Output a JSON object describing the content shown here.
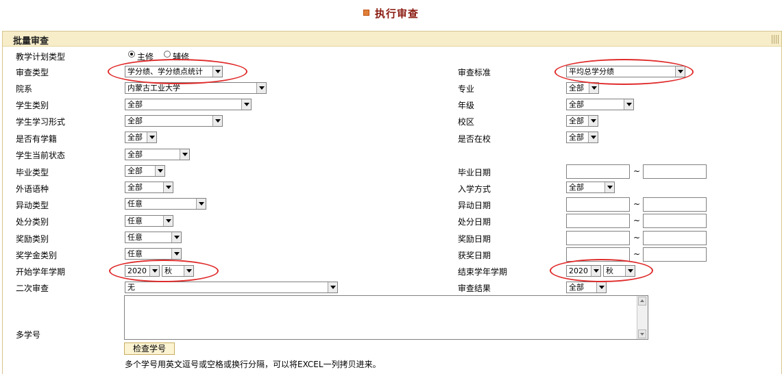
{
  "page_title": "执行审查",
  "panel_title": "批量审查",
  "plan_type": {
    "label": "教学计划类型",
    "options": [
      {
        "label": "主修",
        "checked": true
      },
      {
        "label": "辅修",
        "checked": false
      }
    ]
  },
  "fields": {
    "review_type": {
      "label": "审查类型",
      "value": "学分绩、学分绩点统计"
    },
    "review_standard": {
      "label": "审查标准",
      "value": "平均总学分绩"
    },
    "department": {
      "label": "院系",
      "value": "内蒙古工业大学"
    },
    "major": {
      "label": "专业",
      "value": "全部"
    },
    "student_category": {
      "label": "学生类别",
      "value": "全部"
    },
    "grade": {
      "label": "年级",
      "value": "全部"
    },
    "study_form": {
      "label": "学生学习形式",
      "value": "全部"
    },
    "campus": {
      "label": "校区",
      "value": "全部"
    },
    "has_status": {
      "label": "是否有学籍",
      "value": "全部"
    },
    "in_school": {
      "label": "是否在校",
      "value": "全部"
    },
    "current_state": {
      "label": "学生当前状态",
      "value": "全部"
    },
    "graduation_type": {
      "label": "毕业类型",
      "value": "全部"
    },
    "graduation_date": {
      "label": "毕业日期"
    },
    "language": {
      "label": "外语语种",
      "value": "全部"
    },
    "admission_method": {
      "label": "入学方式",
      "value": "全部"
    },
    "change_type": {
      "label": "异动类型",
      "value": "任意"
    },
    "change_date": {
      "label": "异动日期"
    },
    "punishment_type": {
      "label": "处分类别",
      "value": "任意"
    },
    "punishment_date": {
      "label": "处分日期"
    },
    "award_type": {
      "label": "奖励类别",
      "value": "任意"
    },
    "award_date": {
      "label": "奖励日期"
    },
    "scholarship_type": {
      "label": "奖学金类别",
      "value": "任意"
    },
    "scholarship_date": {
      "label": "获奖日期"
    },
    "start_term": {
      "label": "开始学年学期",
      "year": "2020",
      "season": "秋"
    },
    "end_term": {
      "label": "结束学年学期",
      "year": "2020",
      "season": "秋"
    },
    "second_review": {
      "label": "二次审查",
      "value": "无"
    },
    "review_result": {
      "label": "审查结果",
      "value": "全部"
    },
    "multi_id": {
      "label": "多学号"
    }
  },
  "tilde": "~",
  "check_button": "检查学号",
  "note": "多个学号用英文逗号或空格或换行分隔，可以将EXCEL一列拷贝进来。",
  "colors": {
    "title": "#8b1c12",
    "header_bg": "#f7edc9",
    "panel_border": "#d7c58e",
    "annotation": "#e02a2a",
    "button_bg": "#fbf3d2"
  }
}
